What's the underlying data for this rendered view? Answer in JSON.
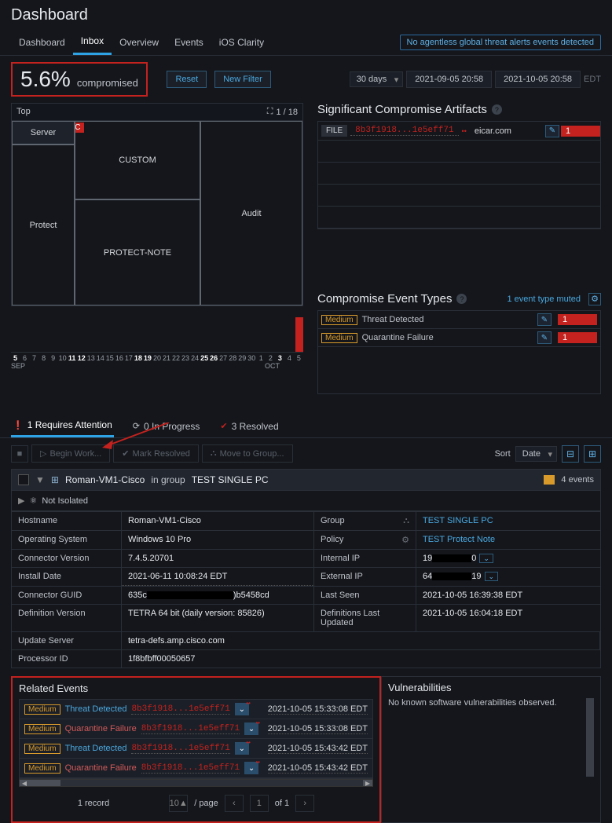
{
  "page_title": "Dashboard",
  "tabs": [
    "Dashboard",
    "Inbox",
    "Overview",
    "Events",
    "iOS Clarity"
  ],
  "active_tab": 1,
  "alert_banner": "No agentless global threat alerts events detected",
  "compromised": {
    "percent": "5.6%",
    "label": "compromised"
  },
  "filters": {
    "reset": "Reset",
    "new_filter": "New Filter",
    "range": "30 days",
    "start": "2021-09-05 20:58",
    "end": "2021-10-05 20:58",
    "tz": "EDT"
  },
  "treemap": {
    "title": "Top",
    "pager": "1 / 18",
    "badge": "TEST SINGLE PC",
    "cells": {
      "server": "Server",
      "protect": "Protect",
      "custom": "CUSTOM",
      "protect_note": "PROTECT-NOTE",
      "audit": "Audit"
    }
  },
  "timeline": {
    "days": [
      "5",
      "6",
      "7",
      "8",
      "9",
      "10",
      "11",
      "12",
      "13",
      "14",
      "15",
      "16",
      "17",
      "18",
      "19",
      "20",
      "21",
      "22",
      "23",
      "24",
      "25",
      "26",
      "27",
      "28",
      "29",
      "30",
      "1",
      "2",
      "3",
      "4",
      "5"
    ],
    "bold_idx": [
      0,
      6,
      7,
      13,
      14,
      20,
      21,
      28
    ],
    "month_left": "SEP",
    "month_right": "OCT"
  },
  "artifacts": {
    "title": "Significant Compromise Artifacts",
    "rows": [
      {
        "type": "FILE",
        "hash": "8b3f1918...1e5eff71",
        "domain": "eicar.com",
        "count": "1"
      }
    ]
  },
  "event_types": {
    "title": "Compromise Event Types",
    "muted": "1 event type muted",
    "rows": [
      {
        "sev": "Medium",
        "name": "Threat Detected",
        "count": "1"
      },
      {
        "sev": "Medium",
        "name": "Quarantine Failure",
        "count": "1"
      }
    ]
  },
  "status_tabs": [
    {
      "label": "1 Requires Attention",
      "icon": "!"
    },
    {
      "label": "0 In Progress",
      "icon": "⟳"
    },
    {
      "label": "3 Resolved",
      "icon": "✓"
    }
  ],
  "actions": {
    "begin": "Begin Work...",
    "resolve": "Mark Resolved",
    "move": "Move to Group...",
    "sort_label": "Sort",
    "sort_value": "Date"
  },
  "asset": {
    "host": "Roman-VM1-Cisco",
    "group_prefix": "in group",
    "group": "TEST SINGLE PC",
    "events": "4 events",
    "iso": "Not Isolated"
  },
  "details": {
    "hostname_l": "Hostname",
    "hostname_v": "Roman-VM1-Cisco",
    "group_l": "Group",
    "group_v": "TEST SINGLE PC",
    "os_l": "Operating System",
    "os_v": "Windows 10 Pro",
    "policy_l": "Policy",
    "policy_v": "TEST Protect Note",
    "conn_l": "Connector Version",
    "conn_v": "7.4.5.20701",
    "intip_l": "Internal IP",
    "intip_pre": "19",
    "intip_suf": "0",
    "inst_l": "Install Date",
    "inst_v": "2021-06-11 10:08:24 EDT",
    "extip_l": "External IP",
    "extip_pre": "64",
    "extip_suf": "19",
    "guid_l": "Connector GUID",
    "guid_pre": "635c",
    "guid_suf": ")b5458cd",
    "seen_l": "Last Seen",
    "seen_v": "2021-10-05 16:39:38 EDT",
    "def_l": "Definition Version",
    "def_v": "TETRA 64 bit (daily version: 85826)",
    "defu_l": "Definitions Last Updated",
    "defu_v": "2021-10-05 16:04:18 EDT",
    "upd_l": "Update Server",
    "upd_v": "tetra-defs.amp.cisco.com",
    "proc_l": "Processor ID",
    "proc_v": "1f8bfbff00050657"
  },
  "related": {
    "title": "Related Events",
    "rows": [
      {
        "sev": "Medium",
        "evt": "Threat Detected",
        "cls": "",
        "hash": "8b3f1918...1e5eff71",
        "ts": "2021-10-05 15:33:08 EDT"
      },
      {
        "sev": "Medium",
        "evt": "Quarantine Failure",
        "cls": "red",
        "hash": "8b3f1918...1e5eff71",
        "ts": "2021-10-05 15:33:08 EDT"
      },
      {
        "sev": "Medium",
        "evt": "Threat Detected",
        "cls": "",
        "hash": "8b3f1918...1e5eff71",
        "ts": "2021-10-05 15:43:42 EDT"
      },
      {
        "sev": "Medium",
        "evt": "Quarantine Failure",
        "cls": "red",
        "hash": "8b3f1918...1e5eff71",
        "ts": "2021-10-05 15:43:42 EDT"
      }
    ],
    "record": "1 record",
    "per_page": "10",
    "page_suffix": "/ page",
    "page": "1",
    "of": "of 1"
  },
  "vuln": {
    "title": "Vulnerabilities",
    "body": "No known software vulnerabilities observed."
  }
}
